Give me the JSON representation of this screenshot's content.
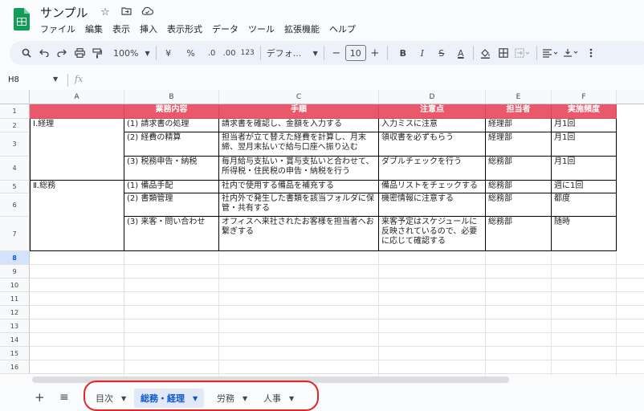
{
  "doc": {
    "title": "サンプル",
    "icons": [
      "star-icon",
      "move-icon",
      "cloud-status-icon"
    ]
  },
  "menu": [
    "ファイル",
    "編集",
    "表示",
    "挿入",
    "表示形式",
    "データ",
    "ツール",
    "拡張機能",
    "ヘルプ"
  ],
  "toolbar": {
    "zoom": "100%",
    "currency": "¥",
    "percent": "%",
    "dec_decrease": ".0",
    "dec_increase": ".00",
    "format_123": "123",
    "font": "デフォ...",
    "font_size": "10",
    "minus": "−",
    "plus": "+",
    "bold": "B",
    "italic": "I",
    "strike": "S",
    "text_color": "A"
  },
  "formula": {
    "name_box": "H8",
    "fx": "fx"
  },
  "columns": [
    "A",
    "B",
    "C",
    "D",
    "E",
    "F"
  ],
  "rows": [
    "1",
    "2",
    "3",
    "4",
    "5",
    "6",
    "7",
    "8",
    "9",
    "10",
    "11",
    "12",
    "13",
    "14",
    "15",
    "16"
  ],
  "table": {
    "header": [
      "業務内容",
      "手順",
      "注意点",
      "担当者",
      "実施頻度"
    ],
    "categories": [
      "Ⅰ.経理",
      "Ⅱ.総務"
    ],
    "items": [
      [
        "(1) 請求書の処理",
        "請求書を確認し、金額を入力する",
        "入力ミスに注意",
        "経理部",
        "月1回"
      ],
      [
        "(2) 経費の精算",
        "担当者が立て替えた経費を計算し、月末締、翌月末払いで給与口座へ振り込む",
        "領収書を必ずもらう",
        "経理部",
        "月1回"
      ],
      [
        "(3) 税務申告・納税",
        "毎月給与支払い・賞与支払いと合わせて、所得税・住民税の申告・納税を行う",
        "ダブルチェックを行う",
        "総務部",
        "月1回"
      ],
      [
        "(1) 備品手配",
        "社内で使用する備品を補充する",
        "備品リストをチェックする",
        "総務部",
        "週に1回"
      ],
      [
        "(2) 書類管理",
        "社内外で発生した書類を該当フォルダに保管・共有する",
        "機密情報に注意する",
        "総務部",
        "都度"
      ],
      [
        "(3) 来客・問い合わせ",
        "オフィスへ来社されたお客様を担当者へお繋ぎする",
        "来客予定はスケジュールに反映されているので、必要に応じて確認する",
        "総務部",
        "随時"
      ]
    ]
  },
  "sheets": [
    {
      "label": "目次",
      "active": false
    },
    {
      "label": "総務・経理",
      "active": true
    },
    {
      "label": "労務",
      "active": false
    },
    {
      "label": "人事",
      "active": false
    }
  ],
  "colors": {
    "header_fill": "#e8596b",
    "active_tab": "#0b57d0",
    "highlight_ring": "#e0262a"
  }
}
